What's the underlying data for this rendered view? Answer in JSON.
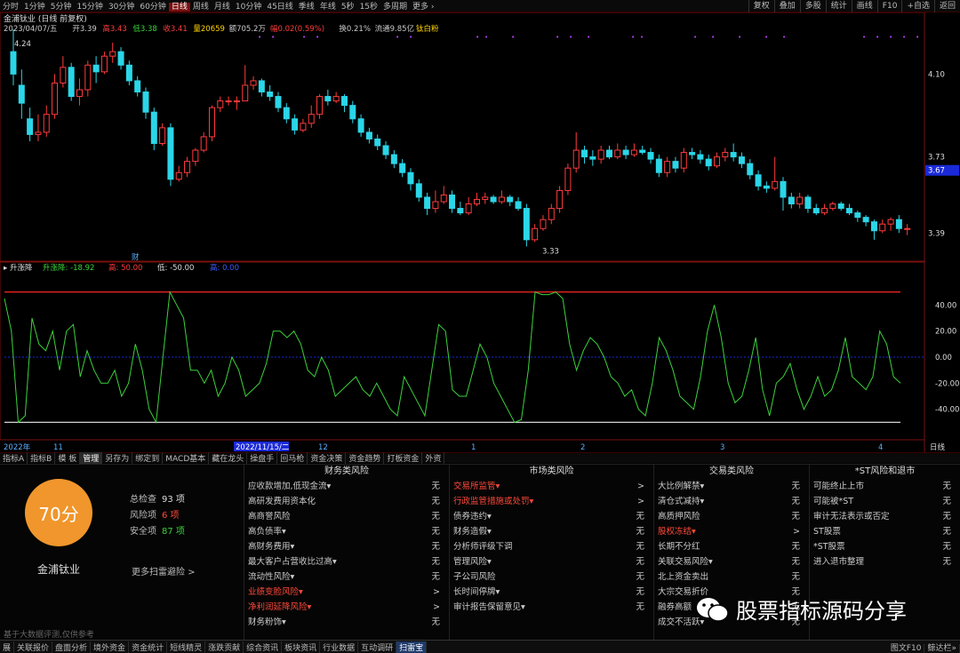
{
  "toolbar": {
    "periods": [
      "分时",
      "1分钟",
      "5分钟",
      "15分钟",
      "30分钟",
      "60分钟",
      "日线",
      "周线",
      "月线",
      "10分钟",
      "45日线",
      "季线",
      "年线",
      "5秒",
      "15秒",
      "多周期",
      "更多 ›"
    ],
    "active": "日线",
    "right": [
      "复权",
      "叠加",
      "多股",
      "统计",
      "画线",
      "F10",
      "+自选",
      "返回"
    ]
  },
  "header": {
    "title": "金浦钛业 (日线 前复权)",
    "info": [
      {
        "t": "2023/04/07/五",
        "c": "#c8c8c8"
      },
      {
        "t": "开3.39",
        "c": "#c8c8c8"
      },
      {
        "t": "高3.43",
        "c": "#ff3b3b"
      },
      {
        "t": "低3.38",
        "c": "#3bd23b"
      },
      {
        "t": "收3.41",
        "c": "#ff3b3b"
      },
      {
        "t": "量20659",
        "c": "#ffd400"
      },
      {
        "t": "额705.2万",
        "c": "#c8c8c8"
      },
      {
        "t": "幅0.02(0.59%)",
        "c": "#ff3b3b"
      },
      {
        "t": "换0.21%",
        "c": "#c8c8c8"
      },
      {
        "t": "流通9.85亿",
        "c": "#c8c8c8"
      },
      {
        "t": "钛白粉",
        "c": "#ffd400"
      }
    ]
  },
  "chart_data": [
    {
      "type": "candlestick",
      "price_ticks": [
        "4.10",
        "3.73",
        "3.39"
      ],
      "current_price": "3.67",
      "high_label": "4.24",
      "low_label": "3.33",
      "note_marker": "财",
      "candles": [
        [
          4.2,
          4.1,
          4.3,
          4.05
        ],
        [
          4.05,
          3.97,
          4.12,
          3.9
        ],
        [
          3.9,
          3.83,
          3.95,
          3.8
        ],
        [
          3.83,
          3.84,
          3.92,
          3.8
        ],
        [
          3.84,
          3.92,
          3.96,
          3.82
        ],
        [
          3.92,
          4.06,
          4.1,
          3.9
        ],
        [
          4.06,
          4.13,
          4.18,
          4.04
        ],
        [
          4.13,
          4.0,
          4.15,
          3.98
        ],
        [
          4.0,
          4.03,
          4.08,
          3.96
        ],
        [
          4.03,
          4.14,
          4.16,
          4.0
        ],
        [
          4.14,
          4.11,
          4.18,
          4.06
        ],
        [
          4.11,
          4.18,
          4.2,
          4.1
        ],
        [
          4.18,
          4.2,
          4.24,
          4.15
        ],
        [
          4.2,
          4.14,
          4.22,
          4.12
        ],
        [
          4.14,
          4.07,
          4.16,
          4.05
        ],
        [
          4.07,
          4.02,
          4.09,
          4.0
        ],
        [
          4.02,
          3.93,
          4.04,
          3.9
        ],
        [
          3.93,
          3.79,
          3.95,
          3.76
        ],
        [
          3.79,
          3.86,
          3.88,
          3.78
        ],
        [
          3.86,
          3.63,
          3.88,
          3.6
        ],
        [
          3.63,
          3.66,
          3.69,
          3.62
        ],
        [
          3.66,
          3.71,
          3.73,
          3.64
        ],
        [
          3.71,
          3.76,
          3.77,
          3.69
        ],
        [
          3.76,
          3.82,
          3.84,
          3.75
        ],
        [
          3.82,
          3.95,
          3.96,
          3.8
        ],
        [
          3.95,
          3.98,
          4.0,
          3.93
        ],
        [
          3.98,
          3.98,
          4.0,
          3.96
        ],
        [
          3.98,
          3.98,
          4.0,
          3.94
        ],
        [
          3.98,
          4.05,
          4.14,
          4.03
        ],
        [
          4.05,
          4.07,
          4.09,
          4.03
        ],
        [
          4.07,
          4.02,
          4.08,
          4.0
        ],
        [
          4.02,
          4.0,
          4.05,
          3.98
        ],
        [
          4.0,
          3.95,
          4.02,
          3.93
        ],
        [
          3.95,
          3.9,
          3.97,
          3.88
        ],
        [
          3.9,
          3.85,
          3.92,
          3.83
        ],
        [
          3.85,
          3.88,
          3.9,
          3.84
        ],
        [
          3.88,
          3.92,
          3.96,
          3.86
        ],
        [
          3.92,
          4.0,
          4.01,
          3.9
        ],
        [
          4.0,
          3.98,
          4.03,
          3.96
        ],
        [
          3.98,
          4.0,
          4.02,
          3.97
        ],
        [
          4.0,
          3.96,
          4.01,
          3.93
        ],
        [
          3.96,
          3.9,
          3.98,
          3.88
        ],
        [
          3.9,
          3.84,
          3.92,
          3.82
        ],
        [
          3.84,
          3.81,
          3.86,
          3.79
        ],
        [
          3.81,
          3.78,
          3.83,
          3.76
        ],
        [
          3.78,
          3.74,
          3.8,
          3.72
        ],
        [
          3.74,
          3.7,
          3.76,
          3.68
        ],
        [
          3.7,
          3.66,
          3.72,
          3.64
        ],
        [
          3.66,
          3.61,
          3.68,
          3.58
        ],
        [
          3.61,
          3.55,
          3.63,
          3.53
        ],
        [
          3.55,
          3.5,
          3.57,
          3.47
        ],
        [
          3.5,
          3.53,
          3.58,
          3.48
        ],
        [
          3.53,
          3.56,
          3.6,
          3.52
        ],
        [
          3.56,
          3.5,
          3.58,
          3.48
        ],
        [
          3.5,
          3.48,
          3.53,
          3.47
        ],
        [
          3.48,
          3.52,
          3.55,
          3.47
        ],
        [
          3.52,
          3.54,
          3.57,
          3.51
        ],
        [
          3.54,
          3.55,
          3.57,
          3.52
        ],
        [
          3.55,
          3.53,
          3.56,
          3.52
        ],
        [
          3.53,
          3.55,
          3.58,
          3.52
        ],
        [
          3.55,
          3.53,
          3.56,
          3.51
        ],
        [
          3.53,
          3.5,
          3.55,
          3.49
        ],
        [
          3.5,
          3.36,
          3.52,
          3.33
        ],
        [
          3.36,
          3.41,
          3.43,
          3.35
        ],
        [
          3.41,
          3.45,
          3.47,
          3.4
        ],
        [
          3.45,
          3.5,
          3.52,
          3.43
        ],
        [
          3.5,
          3.58,
          3.6,
          3.48
        ],
        [
          3.58,
          3.68,
          3.7,
          3.56
        ],
        [
          3.68,
          3.76,
          3.84,
          3.66
        ],
        [
          3.76,
          3.73,
          3.78,
          3.7
        ],
        [
          3.73,
          3.72,
          3.76,
          3.69
        ],
        [
          3.72,
          3.76,
          3.78,
          3.7
        ],
        [
          3.76,
          3.73,
          3.78,
          3.72
        ],
        [
          3.73,
          3.76,
          3.79,
          3.72
        ],
        [
          3.76,
          3.74,
          3.78,
          3.72
        ],
        [
          3.74,
          3.76,
          3.79,
          3.73
        ],
        [
          3.76,
          3.75,
          3.78,
          3.74
        ],
        [
          3.75,
          3.72,
          3.77,
          3.7
        ],
        [
          3.72,
          3.66,
          3.74,
          3.64
        ],
        [
          3.66,
          3.71,
          3.73,
          3.64
        ],
        [
          3.71,
          3.68,
          3.73,
          3.66
        ],
        [
          3.68,
          3.75,
          3.77,
          3.66
        ],
        [
          3.75,
          3.74,
          3.77,
          3.72
        ],
        [
          3.74,
          3.72,
          3.76,
          3.7
        ],
        [
          3.72,
          3.69,
          3.74,
          3.67
        ],
        [
          3.69,
          3.73,
          3.75,
          3.68
        ],
        [
          3.73,
          3.75,
          3.77,
          3.71
        ],
        [
          3.75,
          3.73,
          3.79,
          3.71
        ],
        [
          3.73,
          3.7,
          3.75,
          3.68
        ],
        [
          3.7,
          3.65,
          3.72,
          3.63
        ],
        [
          3.65,
          3.6,
          3.67,
          3.58
        ],
        [
          3.6,
          3.59,
          3.62,
          3.57
        ],
        [
          3.59,
          3.62,
          3.73,
          3.58
        ],
        [
          3.62,
          3.55,
          3.64,
          3.49
        ],
        [
          3.55,
          3.52,
          3.57,
          3.5
        ],
        [
          3.52,
          3.55,
          3.57,
          3.5
        ],
        [
          3.55,
          3.5,
          3.56,
          3.48
        ],
        [
          3.5,
          3.48,
          3.52,
          3.47
        ],
        [
          3.48,
          3.5,
          3.52,
          3.47
        ],
        [
          3.5,
          3.52,
          3.53,
          3.49
        ],
        [
          3.52,
          3.5,
          3.53,
          3.49
        ],
        [
          3.5,
          3.48,
          3.52,
          3.47
        ],
        [
          3.48,
          3.46,
          3.49,
          3.44
        ],
        [
          3.46,
          3.44,
          3.47,
          3.42
        ],
        [
          3.44,
          3.4,
          3.45,
          3.36
        ],
        [
          3.4,
          3.43,
          3.45,
          3.39
        ],
        [
          3.43,
          3.45,
          3.46,
          3.4
        ],
        [
          3.45,
          3.41,
          3.47,
          3.39
        ],
        [
          3.41,
          3.41,
          3.43,
          3.38
        ]
      ]
    },
    {
      "type": "line",
      "title": "升涨降",
      "series_label": "升涨降: -18.92",
      "high_label": "高: 50.00",
      "low_label": "低: -50.00",
      "extra_label": "高: 0.00",
      "ylim": [
        -60,
        60
      ],
      "yticks": [
        "40.00",
        "20.00",
        "0.00",
        "-20.00",
        "-40.00"
      ],
      "upper": 50,
      "lower": -50,
      "mid": 0,
      "values": [
        45,
        20,
        -50,
        -45,
        30,
        10,
        5,
        20,
        -10,
        20,
        25,
        -15,
        5,
        -10,
        -20,
        -20,
        -10,
        -30,
        -20,
        10,
        -10,
        -40,
        -50,
        0,
        50,
        40,
        30,
        -10,
        -10,
        -20,
        -10,
        -30,
        -20,
        0,
        -10,
        -30,
        -25,
        -20,
        -5,
        20,
        20,
        15,
        20,
        10,
        -10,
        -15,
        0,
        -10,
        -30,
        -25,
        -20,
        -15,
        -25,
        -30,
        -20,
        -30,
        -40,
        -45,
        -15,
        -25,
        -35,
        -45,
        -10,
        25,
        20,
        -25,
        -30,
        -30,
        -10,
        10,
        0,
        -20,
        -30,
        -40,
        -50,
        -48,
        -10,
        50,
        48,
        48,
        50,
        45,
        10,
        -10,
        5,
        15,
        10,
        0,
        -15,
        -20,
        -30,
        -25,
        -40,
        -45,
        -20,
        15,
        5,
        -10,
        -30,
        -35,
        -40,
        -15,
        20,
        40,
        15,
        -20,
        -35,
        -30,
        -10,
        15,
        -25,
        -45,
        -20,
        -15,
        -5,
        -25,
        -40,
        -30,
        -15,
        -30,
        -25,
        -10,
        15,
        -15,
        -20,
        -25,
        -15,
        20,
        10,
        -15,
        -20
      ],
      "dates": [
        "2022年",
        "11",
        "2022/11/15/二",
        "12",
        "1",
        "2",
        "3",
        "4",
        "日线"
      ]
    }
  ],
  "bottom_tabs": {
    "items": [
      "指标A",
      "指标B",
      "模 板",
      "管理",
      "另存为",
      "绑定到",
      "MACD基本",
      "藏在龙头",
      "操盘手",
      "回马枪",
      "资金决策",
      "资金趋势",
      "打板资金",
      "外资"
    ],
    "active": "管理"
  },
  "risk": {
    "score": "70分",
    "company": "金浦钛业",
    "total_label": "总检查",
    "total": "93 项",
    "risk_label": "风险项",
    "risk": "6 项",
    "safe_label": "安全项",
    "safe": "87 项",
    "more": "更多扫雷避险 >",
    "columns": [
      {
        "title": "财务类风险",
        "items": [
          {
            "l": "应收款增加,低现金流▾",
            "s": "无",
            "r": false
          },
          {
            "l": "高研发费用资本化",
            "s": "无",
            "r": false
          },
          {
            "l": "高商誉风险",
            "s": "无",
            "r": false
          },
          {
            "l": "高负债率▾",
            "s": "无",
            "r": false
          },
          {
            "l": "高财务费用▾",
            "s": "无",
            "r": false
          },
          {
            "l": "最大客户占营收比过高▾",
            "s": "无",
            "r": false
          },
          {
            "l": "流动性风险▾",
            "s": "无",
            "r": false
          },
          {
            "l": "业绩变脸风险▾",
            "s": ">",
            "r": true
          },
          {
            "l": "净利润延降风险▾",
            "s": ">",
            "r": true
          },
          {
            "l": "财务粉饰▾",
            "s": "无",
            "r": false
          }
        ]
      },
      {
        "title": "市场类风险",
        "items": [
          {
            "l": "交易所监管▾",
            "s": ">",
            "r": true
          },
          {
            "l": "行政监管措施或处罚▾",
            "s": ">",
            "r": true
          },
          {
            "l": "债券违约▾",
            "s": "无",
            "r": false
          },
          {
            "l": "财务造假▾",
            "s": "无",
            "r": false
          },
          {
            "l": "分析师评级下调",
            "s": "无",
            "r": false
          },
          {
            "l": "管理风险▾",
            "s": "无",
            "r": false
          },
          {
            "l": "子公司风险",
            "s": "无",
            "r": false
          },
          {
            "l": "长时间停牌▾",
            "s": "无",
            "r": false
          },
          {
            "l": "审计报告保留意见▾",
            "s": "无",
            "r": false
          }
        ]
      },
      {
        "title": "交易类风险",
        "items": [
          {
            "l": "大比例解禁▾",
            "s": "无",
            "r": false
          },
          {
            "l": "清仓式减持▾",
            "s": "无",
            "r": false
          },
          {
            "l": "高质押风险",
            "s": "无",
            "r": false
          },
          {
            "l": "股权冻结▾",
            "s": ">",
            "r": true
          },
          {
            "l": "长期不分红",
            "s": "无",
            "r": false
          },
          {
            "l": "关联交易风险▾",
            "s": "无",
            "r": false
          },
          {
            "l": "北上资金卖出",
            "s": "无",
            "r": false
          },
          {
            "l": "大宗交易折价",
            "s": "无",
            "r": false
          },
          {
            "l": "融券高额",
            "s": "无",
            "r": false
          },
          {
            "l": "成交不活跃▾",
            "s": "无",
            "r": false
          }
        ]
      },
      {
        "title": "*ST风险和退市",
        "items": [
          {
            "l": "可能终止上市",
            "s": "无",
            "r": false
          },
          {
            "l": "可能被*ST",
            "s": "无",
            "r": false
          },
          {
            "l": "审计无法表示或否定",
            "s": "无",
            "r": false
          },
          {
            "l": "ST股票",
            "s": "无",
            "r": false
          },
          {
            "l": "*ST股票",
            "s": "无",
            "r": false
          },
          {
            "l": "进入退市整理",
            "s": "无",
            "r": false
          }
        ]
      }
    ],
    "footer_note": "基于大数据评测,仅供参考"
  },
  "status_bar": {
    "items": [
      "展",
      "关联报价",
      "盘面分析",
      "境外资金",
      "资金统计",
      "短线精灵",
      "涨跌贡献",
      "综合资讯",
      "板块资讯",
      "行业数据",
      "互动调研",
      "扫雷宝"
    ],
    "active": "扫雷宝",
    "right": "图文F10",
    "right2": "鲸达栏»"
  },
  "watermark": "股票指标源码分享",
  "colors": {
    "up": "#ff3b3b",
    "down": "#2ad6e8",
    "osc": "#3bd23b",
    "grid": "#7a0f0f",
    "bg": "#000000"
  }
}
